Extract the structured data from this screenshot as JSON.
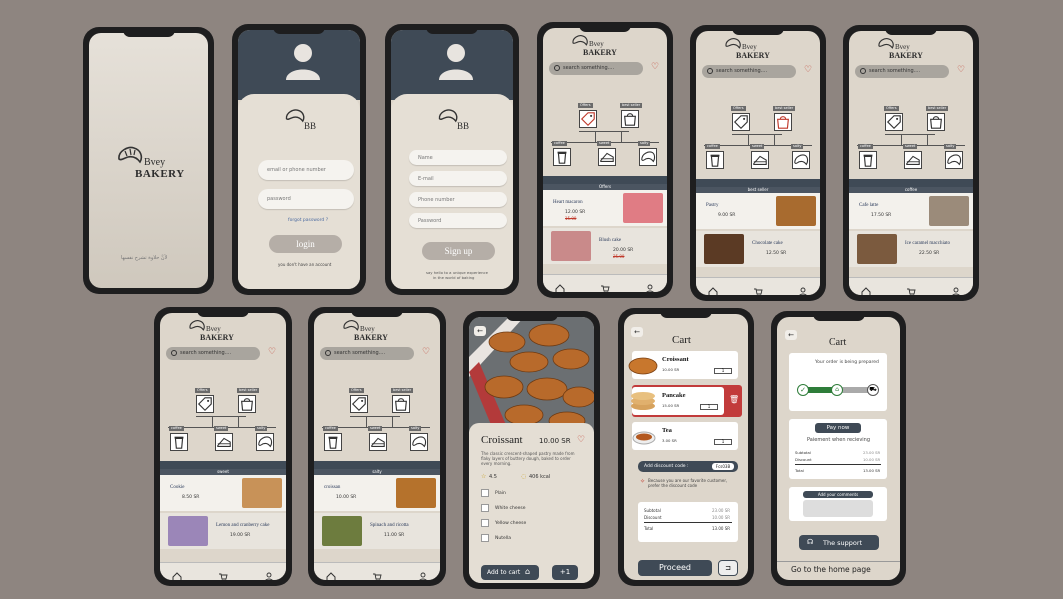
{
  "splash": {
    "brand_top": "Bvey",
    "brand_bottom": "BAKERY",
    "tagline": "لأنَّ حلاوة تشرح نفسها"
  },
  "login": {
    "logo_letters": "BB",
    "email_placeholder": "email or phone number",
    "password_placeholder": "password",
    "forgot": "forgot password ?",
    "button": "login",
    "no_account": "you don't have an account"
  },
  "signup": {
    "logo_letters": "BB",
    "name_placeholder": "Name",
    "email_placeholder": "E-mail",
    "phone_placeholder": "Phone number",
    "password_placeholder": "Password",
    "button": "Sign up",
    "tagline_1": "say hello to a unique experience",
    "tagline_2": "in the world of baking"
  },
  "home": {
    "brand_top": "Bvey",
    "brand_bottom": "BAKERY",
    "search_placeholder": "search something....",
    "categories": {
      "offers": "Offers",
      "best_seller": "best seller",
      "coffee": "coffee",
      "sweet": "sweet",
      "salty": "salty"
    }
  },
  "home_offers": {
    "section": "Offers",
    "items": [
      {
        "name": "Heart macaron",
        "price": "12.00 SR",
        "old_price": "15.00"
      },
      {
        "name": "Blush cake",
        "price": "20.00 SR",
        "old_price": "25.00"
      }
    ]
  },
  "home_best": {
    "section": "best seller",
    "items": [
      {
        "name": "Pastry",
        "price": "9.00 SR"
      },
      {
        "name": "Chocolate cake",
        "price": "12.50 SR"
      }
    ]
  },
  "home_coffee": {
    "section": "coffee",
    "items": [
      {
        "name": "Cafe latte",
        "price": "17.50 SR"
      },
      {
        "name": "Ice caramel macchiato",
        "price": "22.50 SR"
      }
    ]
  },
  "home_sweet": {
    "section": "sweet",
    "items": [
      {
        "name": "Cookie",
        "price": "8.50 SR"
      },
      {
        "name": "Lemon and cranberry cake",
        "price": "19.00 SR"
      }
    ]
  },
  "home_salty": {
    "section": "salty",
    "items": [
      {
        "name": "croissan",
        "price": "10.00 SR"
      },
      {
        "name": "Spinach and ricotta",
        "price": "11.00 SR"
      }
    ]
  },
  "product": {
    "name": "Croissant",
    "price": "10.00 SR",
    "description": "The classic crescent-shaped pastry made from flaky layers of buttery dough, baked to order every morning.",
    "rating": "4.5",
    "kcal": "406 kcal",
    "options": [
      "Plain",
      "White cheese",
      "Yellow cheese",
      "Nutella"
    ],
    "add_to_cart": "Add to cart",
    "qty": "+1"
  },
  "cart": {
    "title": "Cart",
    "items": [
      {
        "name": "Croissant",
        "price": "10.00 SR",
        "qty": "1"
      },
      {
        "name": "Pancake",
        "price": "15.00 SR",
        "qty": "1"
      },
      {
        "name": "Tea",
        "price": "3.00 SR",
        "qty": "1"
      }
    ],
    "discount_label": "Add discount code :",
    "discount_code": "Fcs03B",
    "discount_note": "Because you are our favorite customer, prefer the discount code",
    "subtotal_label": "Subtotal",
    "subtotal": "23.00 SR",
    "discount_line": "Discount",
    "discount_value": "10.00 SR",
    "total_label": "Total",
    "total": "13.00 SR",
    "proceed": "Proceed"
  },
  "order": {
    "title": "Cart",
    "status": "Your order is being prepared",
    "pay_now": "Pay now",
    "payment_note": "Paiement when recieving",
    "subtotal_label": "Subtotal",
    "subtotal": "23.00 SR",
    "discount_label": "Discount",
    "discount": "10.00 SR",
    "total_label": "Total",
    "total": "13.00 SR",
    "comments": "Add your comments",
    "support": "The support",
    "home": "Go to the home page"
  },
  "colors": {
    "background": "#8e8580",
    "screen": "#ddd6cb",
    "accent_red": "#c0392b",
    "dark": "#3f4a56",
    "button_grey": "#b5aea7",
    "success": "#2f7d3a"
  }
}
